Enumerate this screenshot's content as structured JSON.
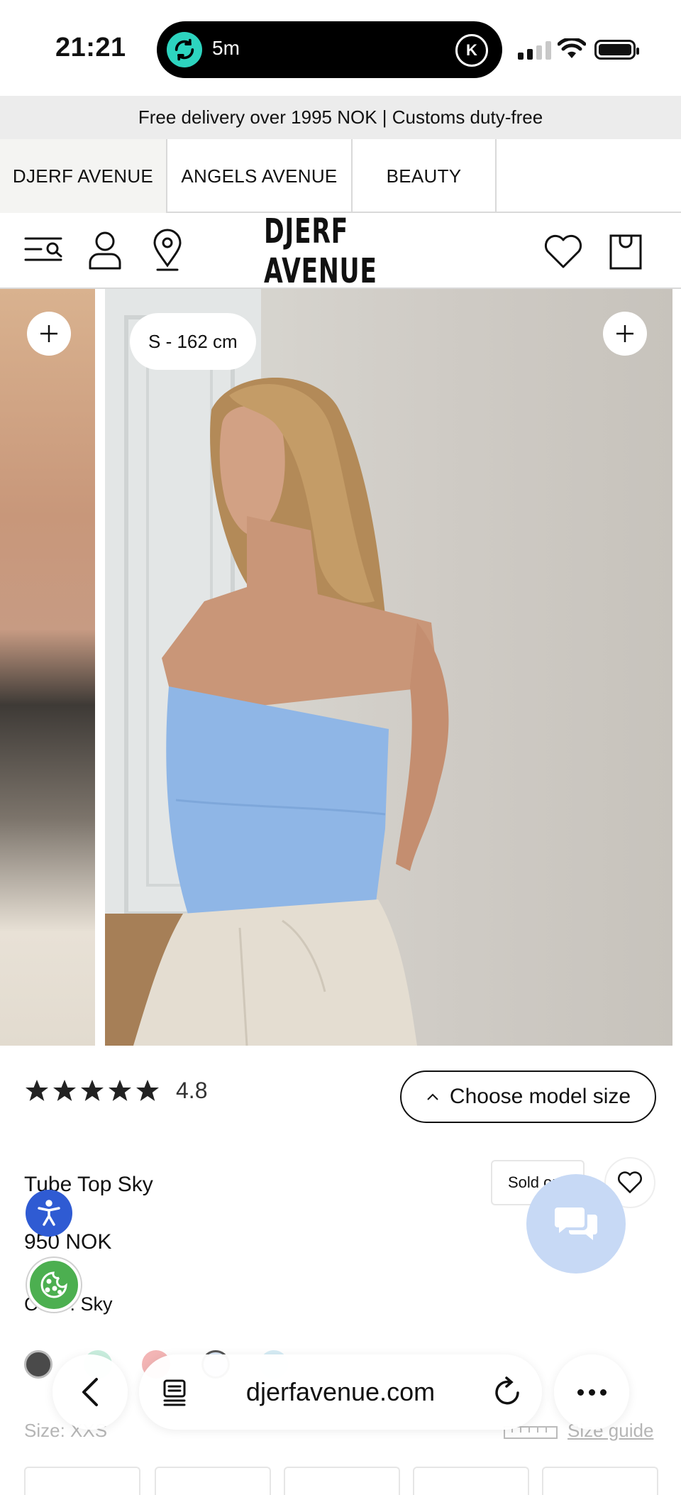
{
  "status_bar": {
    "time": "21:21",
    "activity_label": "5m",
    "activity_badge": "K"
  },
  "promo": {
    "text": "Free delivery over 1995 NOK | Customs duty-free"
  },
  "brand_tabs": [
    {
      "label": "DJERF AVENUE",
      "active": true
    },
    {
      "label": "ANGELS AVENUE",
      "active": false
    },
    {
      "label": "BEAUTY",
      "active": false
    }
  ],
  "header": {
    "logo": "DJERF AVENUE",
    "icons": [
      "menu-search-icon",
      "account-icon",
      "store-locator-icon",
      "wishlist-icon",
      "cart-icon"
    ]
  },
  "gallery": {
    "model_size_label": "S - 162 cm"
  },
  "product": {
    "rating": "4.8",
    "stars": 5,
    "model_size_button": "Choose model size",
    "title": "Tube Top Sky",
    "price": "950 NOK",
    "color_label": "Color: Sky",
    "sold_badge": "Sold out",
    "size_label": "Size: XXS",
    "size_guide": "Size guide",
    "swatch_colors": [
      "#4a4a4a",
      "#c9eede",
      "#f3b5b5",
      "#dbe8f7",
      "#d6ecf5"
    ]
  },
  "browser": {
    "url": "djerfavenue.com"
  },
  "colors": {
    "chat": "#c7d9f5",
    "accessibility": "#2f5bd3",
    "cookie": "#4caf50",
    "island_accent": "#2dd4bf"
  }
}
